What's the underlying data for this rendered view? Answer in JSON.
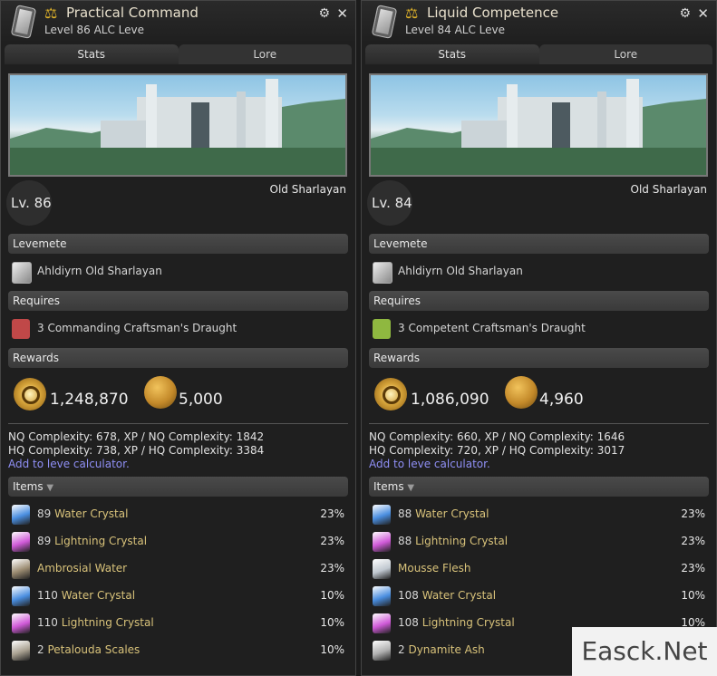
{
  "panels": [
    {
      "title": "Practical Command",
      "subtitle": "Level 86 ALC Leve",
      "tabs": [
        "Stats",
        "Lore"
      ],
      "region": "Old Sharlayan",
      "level": "Lv. 86",
      "levemete_header": "Levemete",
      "levemete": "Ahldiyrn Old Sharlayan",
      "requires_header": "Requires",
      "requires": "3 Commanding Craftsman's Draught",
      "rewards_header": "Rewards",
      "xp": "1,248,870",
      "gil": "5,000",
      "nq_line": "NQ Complexity: 678, XP / NQ Complexity: 1842",
      "hq_line": "HQ Complexity: 738, XP / HQ Complexity: 3384",
      "calc_link": "Add to leve calculator.",
      "items_header": "Items",
      "items": [
        {
          "qty": "89",
          "name": "Water Crystal",
          "pct": "23%",
          "icon": "water-crystal-icon",
          "color": "#4a8ee0"
        },
        {
          "qty": "89",
          "name": "Lightning Crystal",
          "pct": "23%",
          "icon": "lightning-crystal-icon",
          "color": "#d05ad8"
        },
        {
          "qty": "",
          "name": "Ambrosial Water",
          "pct": "23%",
          "icon": "ambrosial-water-icon",
          "color": "#9a8a70"
        },
        {
          "qty": "110",
          "name": "Water Crystal",
          "pct": "10%",
          "icon": "water-crystal-icon",
          "color": "#4a8ee0"
        },
        {
          "qty": "110",
          "name": "Lightning Crystal",
          "pct": "10%",
          "icon": "lightning-crystal-icon",
          "color": "#d05ad8"
        },
        {
          "qty": "2",
          "name": "Petalouda Scales",
          "pct": "10%",
          "icon": "petalouda-scales-icon",
          "color": "#a8a090"
        }
      ]
    },
    {
      "title": "Liquid Competence",
      "subtitle": "Level 84 ALC Leve",
      "tabs": [
        "Stats",
        "Lore"
      ],
      "region": "Old Sharlayan",
      "level": "Lv. 84",
      "levemete_header": "Levemete",
      "levemete": "Ahldiyrn Old Sharlayan",
      "requires_header": "Requires",
      "requires": "3 Competent Craftsman's Draught",
      "rewards_header": "Rewards",
      "xp": "1,086,090",
      "gil": "4,960",
      "nq_line": "NQ Complexity: 660, XP / NQ Complexity: 1646",
      "hq_line": "HQ Complexity: 720, XP / HQ Complexity: 3017",
      "calc_link": "Add to leve calculator.",
      "items_header": "Items",
      "items": [
        {
          "qty": "88",
          "name": "Water Crystal",
          "pct": "23%",
          "icon": "water-crystal-icon",
          "color": "#4a8ee0"
        },
        {
          "qty": "88",
          "name": "Lightning Crystal",
          "pct": "23%",
          "icon": "lightning-crystal-icon",
          "color": "#d05ad8"
        },
        {
          "qty": "",
          "name": "Mousse Flesh",
          "pct": "23%",
          "icon": "mousse-flesh-icon",
          "color": "#c0c8d0"
        },
        {
          "qty": "108",
          "name": "Water Crystal",
          "pct": "10%",
          "icon": "water-crystal-icon",
          "color": "#4a8ee0"
        },
        {
          "qty": "108",
          "name": "Lightning Crystal",
          "pct": "10%",
          "icon": "lightning-crystal-icon",
          "color": "#d05ad8"
        },
        {
          "qty": "2",
          "name": "Dynamite Ash",
          "pct": "",
          "icon": "dynamite-ash-icon",
          "color": "#b0b0b0"
        }
      ]
    }
  ],
  "colors": {
    "link": "#8f8ff5",
    "item_name": "#d8c27a",
    "header": "#e8e0cc"
  },
  "watermark": "Easck.Net"
}
